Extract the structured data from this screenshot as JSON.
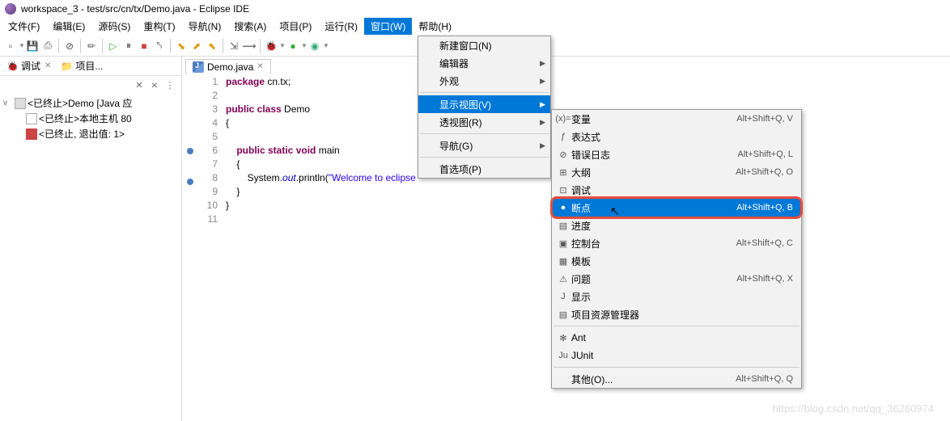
{
  "title": "workspace_3 - test/src/cn/tx/Demo.java - Eclipse IDE",
  "menubar": [
    "文件(F)",
    "编辑(E)",
    "源码(S)",
    "重构(T)",
    "导航(N)",
    "搜索(A)",
    "项目(P)",
    "运行(R)",
    "窗口(W)",
    "帮助(H)"
  ],
  "menubar_active": 8,
  "sidebar": {
    "tabs": [
      {
        "label": "调试",
        "icon": "bug"
      },
      {
        "label": "项目...",
        "icon": "folder"
      }
    ],
    "tree": [
      {
        "level": 0,
        "expand": "v",
        "icon": "term",
        "label": "<已终止>Demo [Java 应"
      },
      {
        "level": 1,
        "expand": "",
        "icon": "run",
        "label": "<已终止>本地主机 80"
      },
      {
        "level": 1,
        "expand": "",
        "icon": "exit",
        "label": "<已终止, 退出值: 1>"
      }
    ]
  },
  "editor": {
    "tab": "Demo.java",
    "lines": [
      {
        "n": 1,
        "segs": [
          {
            "t": "package",
            "c": "kw"
          },
          {
            "t": " cn.tx;",
            "c": "plain"
          }
        ]
      },
      {
        "n": 2,
        "segs": []
      },
      {
        "n": 3,
        "segs": [
          {
            "t": "public class",
            "c": "kw"
          },
          {
            "t": " Demo",
            "c": "plain"
          }
        ]
      },
      {
        "n": 4,
        "segs": [
          {
            "t": "{",
            "c": "plain"
          }
        ]
      },
      {
        "n": 5,
        "segs": []
      },
      {
        "n": 6,
        "segs": [
          {
            "t": "    ",
            "c": "plain"
          },
          {
            "t": "public static void",
            "c": "kw"
          },
          {
            "t": " main",
            "c": "plain"
          }
        ],
        "mark": "blue"
      },
      {
        "n": 7,
        "segs": [
          {
            "t": "    {",
            "c": "plain"
          }
        ]
      },
      {
        "n": 8,
        "segs": [
          {
            "t": "        System.",
            "c": "plain"
          },
          {
            "t": "out",
            "c": "fld"
          },
          {
            "t": ".println(",
            "c": "plain"
          },
          {
            "t": "\"Welcome to eclipse",
            "c": "str"
          }
        ],
        "mark": "blue"
      },
      {
        "n": 9,
        "segs": [
          {
            "t": "    }",
            "c": "plain"
          }
        ]
      },
      {
        "n": 10,
        "segs": [
          {
            "t": "}",
            "c": "plain"
          }
        ]
      },
      {
        "n": 11,
        "segs": []
      }
    ]
  },
  "window_menu": [
    {
      "label": "新建窗口(N)"
    },
    {
      "label": "编辑器",
      "sub": true
    },
    {
      "label": "外观",
      "sub": true
    },
    {
      "sep": true
    },
    {
      "label": "显示视图(V)",
      "sub": true,
      "highlight": true
    },
    {
      "label": "透视图(R)",
      "sub": true
    },
    {
      "sep": true
    },
    {
      "label": "导航(G)",
      "sub": true
    },
    {
      "sep": true
    },
    {
      "label": "首选项(P)"
    }
  ],
  "show_view_menu": [
    {
      "icon": "(x)=",
      "label": "变量",
      "shortcut": "Alt+Shift+Q, V"
    },
    {
      "icon": "ƒ",
      "label": "表达式",
      "shortcut": ""
    },
    {
      "icon": "⊘",
      "label": "错误日志",
      "shortcut": "Alt+Shift+Q, L"
    },
    {
      "icon": "⊞",
      "label": "大纲",
      "shortcut": "Alt+Shift+Q, O"
    },
    {
      "icon": "⊡",
      "label": "调试",
      "shortcut": ""
    },
    {
      "icon": "●",
      "label": "断点",
      "shortcut": "Alt+Shift+Q, B",
      "highlight": true
    },
    {
      "icon": "▤",
      "label": "进度",
      "shortcut": ""
    },
    {
      "icon": "▣",
      "label": "控制台",
      "shortcut": "Alt+Shift+Q, C"
    },
    {
      "icon": "▦",
      "label": "模板",
      "shortcut": ""
    },
    {
      "icon": "⚠",
      "label": "问题",
      "shortcut": "Alt+Shift+Q, X"
    },
    {
      "icon": "J",
      "label": "显示",
      "shortcut": ""
    },
    {
      "icon": "▤",
      "label": "项目资源管理器",
      "shortcut": ""
    },
    {
      "sep": true
    },
    {
      "icon": "✻",
      "label": "Ant",
      "shortcut": ""
    },
    {
      "icon": "Ju",
      "label": "JUnit",
      "shortcut": ""
    },
    {
      "sep": true
    },
    {
      "icon": "",
      "label": "其他(O)...",
      "shortcut": "Alt+Shift+Q, Q"
    }
  ],
  "watermark": "https://blog.csdn.net/qq_36260974"
}
